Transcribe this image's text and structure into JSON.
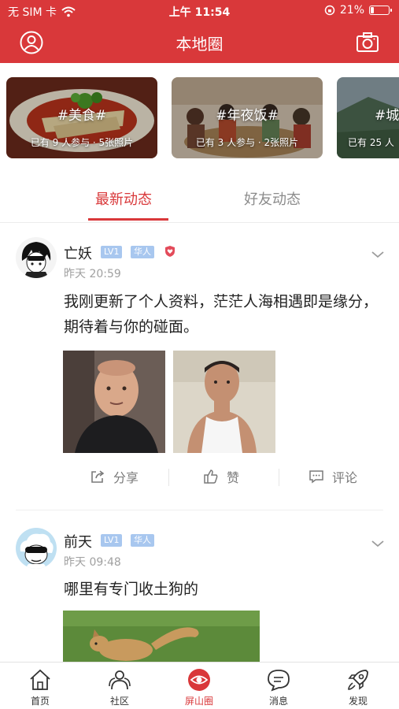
{
  "status_bar": {
    "carrier": "无 SIM 卡",
    "time": "上午 11:54",
    "battery": "21%",
    "battery_level": 0.21
  },
  "header": {
    "title": "本地圈",
    "left_icon": "user-profile-icon",
    "right_icon": "camera-icon"
  },
  "topics": [
    {
      "title": "#美食#",
      "meta": "已有 9 人参与 · 5张照片"
    },
    {
      "title": "#年夜饭#",
      "meta": "已有 3 人参与 · 2张照片"
    },
    {
      "title": "#城",
      "meta": "已有 25 人"
    }
  ],
  "tabs": {
    "active": "最新动态",
    "inactive": "好友动态"
  },
  "posts": [
    {
      "username": "亡妖",
      "level": "LV1",
      "tag": "华人",
      "time": "昨天 20:59",
      "content": "我刚更新了个人资料，茫茫人海相遇即是缘分，期待着与你的碰面。",
      "actions": {
        "share": "分享",
        "like": "赞",
        "comment": "评论"
      }
    },
    {
      "username": "前天",
      "level": "LV1",
      "tag": "华人",
      "time": "昨天 09:48",
      "content": "哪里有专门收土狗的"
    }
  ],
  "tabbar": {
    "items": [
      {
        "label": "首页",
        "icon": "home-icon"
      },
      {
        "label": "社区",
        "icon": "community-icon"
      },
      {
        "label": "屏山圈",
        "icon": "eye-circle-icon"
      },
      {
        "label": "消息",
        "icon": "message-icon"
      },
      {
        "label": "发现",
        "icon": "rocket-icon"
      }
    ],
    "active_index": 2
  },
  "colors": {
    "brand_red": "#d9383a",
    "badge_blue": "#a8c7ef",
    "muted_gray": "#a0a0a0"
  }
}
